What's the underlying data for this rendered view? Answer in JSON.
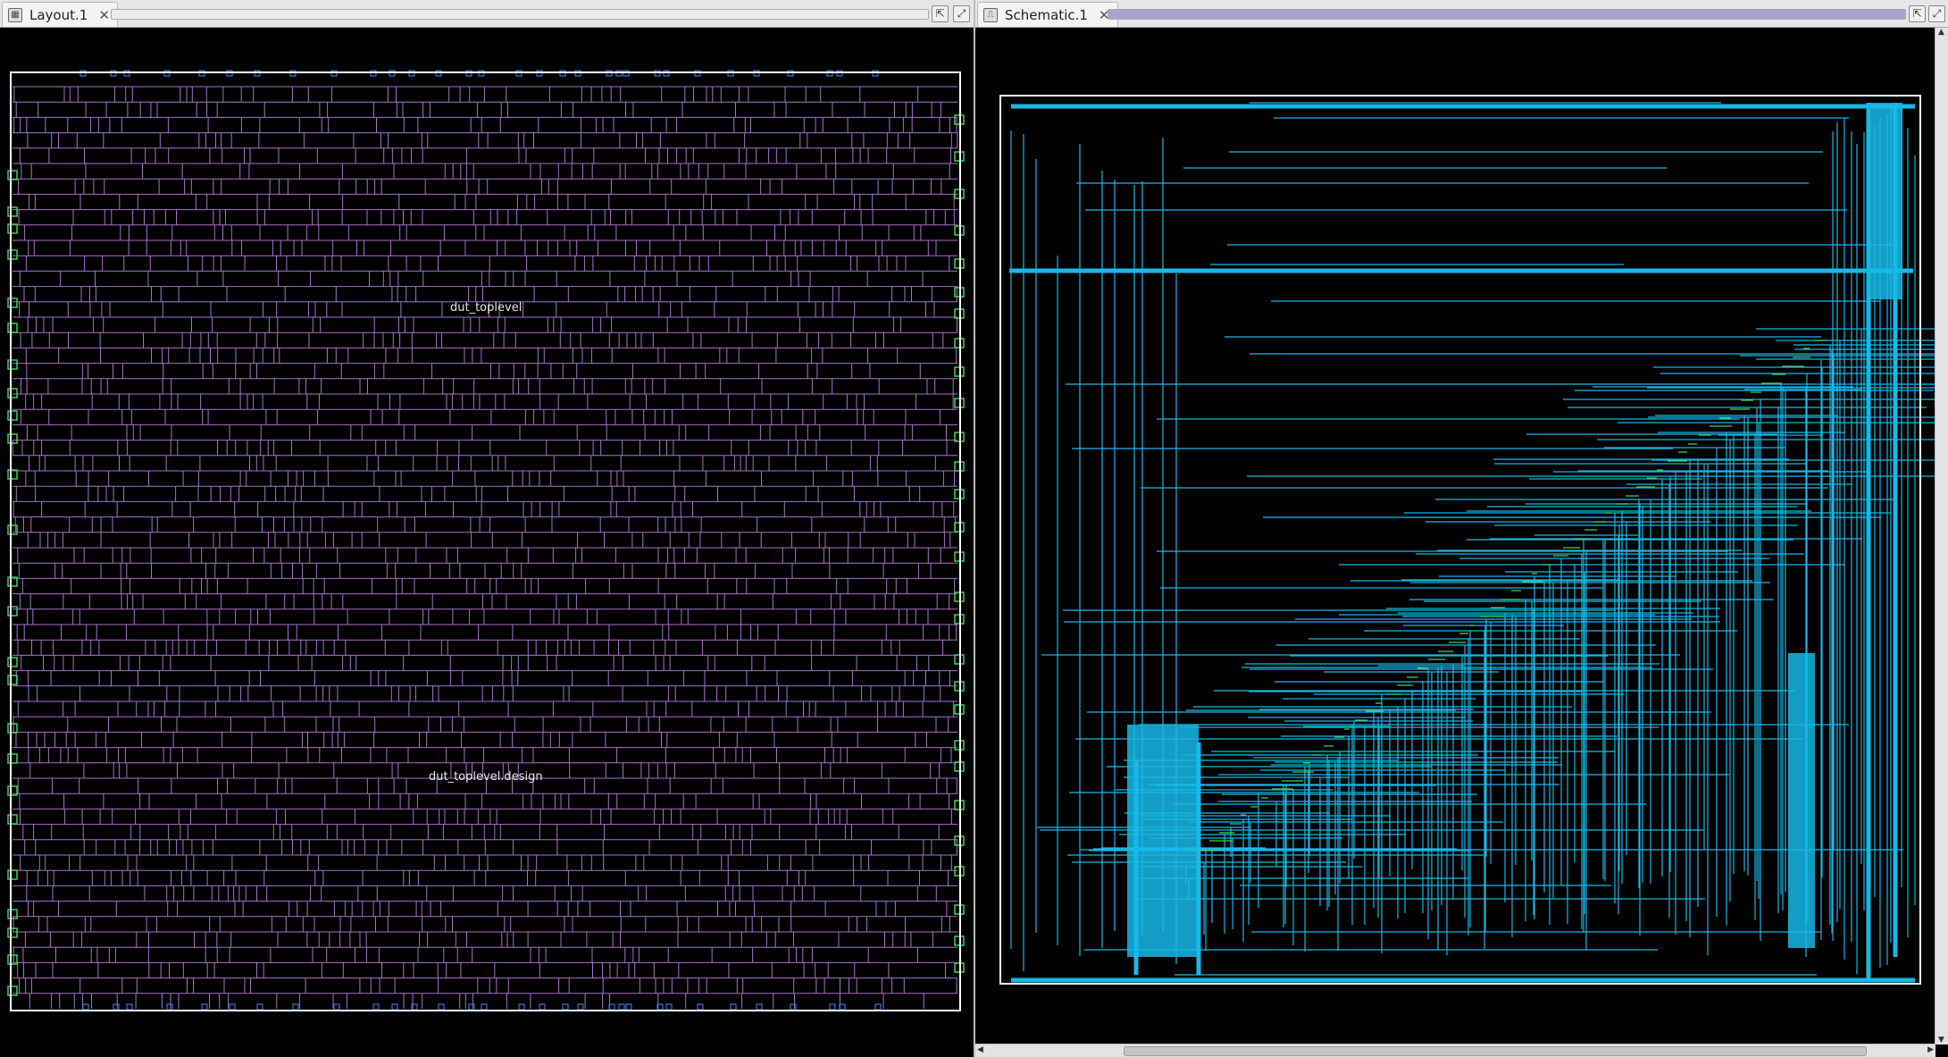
{
  "layout_tab": {
    "title": "Layout.1",
    "close_icon": "close-icon",
    "icon": "layout-view-icon",
    "labels": {
      "top": "dut_toplevel",
      "design": "dut_toplevel.design"
    },
    "colors": {
      "cells": "#a572c8",
      "pins": "#44d05a",
      "io": "#3a6fd8",
      "boundary": "#ffffff"
    }
  },
  "schematic_tab": {
    "title": "Schematic.1",
    "close_icon": "close-icon",
    "icon": "schematic-view-icon",
    "colors": {
      "wires": "#18b8e6",
      "pins": "#44d05a",
      "boundary": "#ffffff"
    }
  },
  "window_buttons": {
    "float": "float-window-icon",
    "maximize": "maximize-icon"
  }
}
